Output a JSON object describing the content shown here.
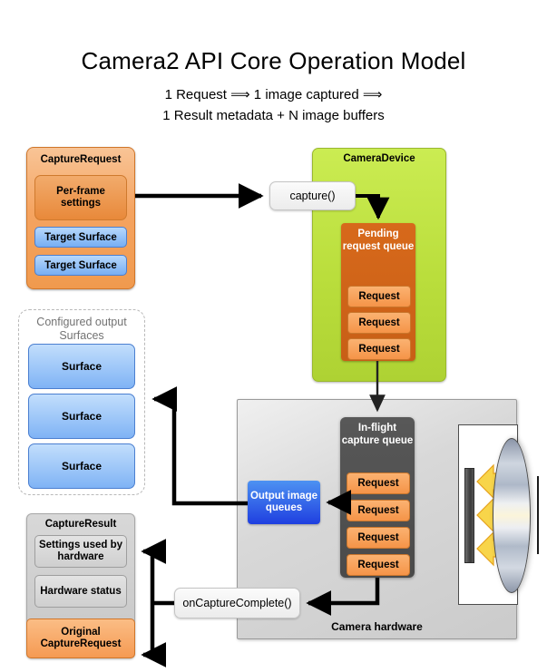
{
  "header": {
    "title": "Camera2 API Core Operation Model",
    "subtitle_line1": "1 Request ⟹ 1 image captured ⟹",
    "subtitle_line2": "1 Result metadata + N image buffers"
  },
  "capture_request": {
    "title": "CaptureRequest",
    "per_frame_settings": "Per-frame settings",
    "target_surfaces": [
      "Target Surface",
      "Target Surface"
    ]
  },
  "configured_output_surfaces": {
    "label": "Configured output Surfaces",
    "surfaces": [
      "Surface",
      "Surface",
      "Surface"
    ]
  },
  "camera_device": {
    "title": "CameraDevice",
    "capture_call": "capture()",
    "pending_request_queue": {
      "title": "Pending request queue",
      "requests": [
        "Request",
        "Request",
        "Request"
      ]
    }
  },
  "camera_hardware": {
    "label": "Camera hardware",
    "in_flight_capture_queue": {
      "title": "In-flight capture queue",
      "requests": [
        "Request",
        "Request",
        "Request",
        "Request"
      ]
    },
    "output_image_queues": "Output image queues"
  },
  "capture_result": {
    "title": "CaptureResult",
    "items": [
      "Settings used by hardware",
      "Hardware status"
    ],
    "original_capture_request": "Original CaptureRequest",
    "callback": "onCaptureComplete()"
  },
  "colors": {
    "capture_request_orange": "#f5a461",
    "target_surface_blue": "#76aef4",
    "camera_device_green": "#bade3c",
    "pending_queue_brown": "#d2691e",
    "request_chip_orange": "#f59448",
    "in_flight_queue_gray": "#4a4a4a",
    "output_queue_blue": "#2a52e8",
    "camera_hardware_gray": "#d3d3d3",
    "capture_result_gray": "#cccccc",
    "light_ray_yellow": "#f8d54a",
    "lens_gray": "#b7c0cd"
  }
}
